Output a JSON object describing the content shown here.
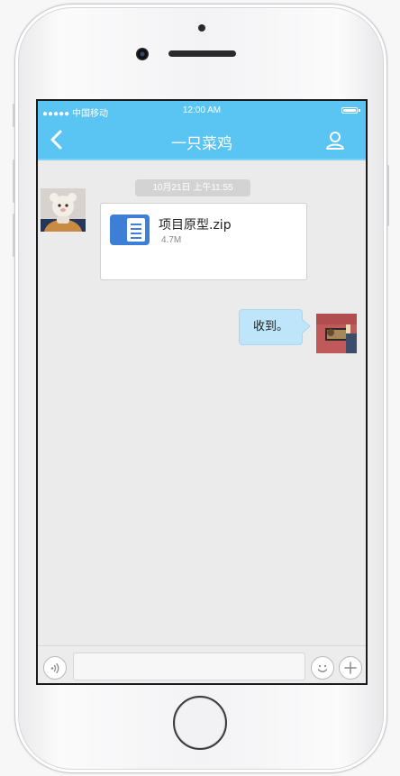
{
  "status_bar": {
    "carrier": "●●●●● 中国移动",
    "time": "12:00 AM"
  },
  "header": {
    "title": "一只菜鸡"
  },
  "chat": {
    "timestamp": "10月21日 上午11:55",
    "messages": [
      {
        "side": "left",
        "type": "file",
        "file_name": "项目原型.zip",
        "file_size": "4.7M"
      },
      {
        "side": "right",
        "type": "text",
        "text": "收到。"
      }
    ]
  },
  "input_bar": {
    "text_value": "",
    "placeholder": ""
  },
  "icons": {
    "back": "chevron-left-icon",
    "profile": "user-icon",
    "voice": "voice-icon",
    "emoji": "smiley-icon",
    "plus": "plus-icon",
    "file": "document-icon"
  },
  "colors": {
    "accent": "#5ac4f3",
    "chat_background": "#ebebeb",
    "sent_bubble": "#bfe5fa",
    "file_icon": "#3d7fd6"
  }
}
